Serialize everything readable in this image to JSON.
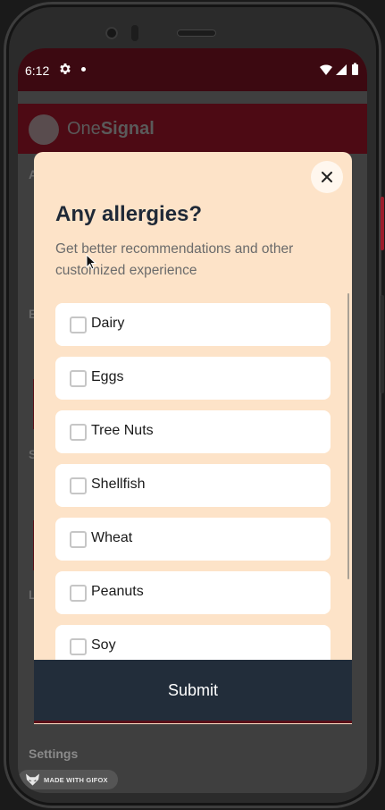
{
  "status_bar": {
    "time": "6:12"
  },
  "app_bar": {
    "title_light": "One",
    "title_bold": "Signal"
  },
  "background": {
    "labels": [
      "A",
      "E",
      "S",
      "L"
    ],
    "settings_label": "Settings"
  },
  "modal": {
    "title": "Any allergies?",
    "description": "Get better recommendations and other customized experience",
    "options": [
      {
        "label": "Dairy",
        "checked": false
      },
      {
        "label": "Eggs",
        "checked": false
      },
      {
        "label": "Tree Nuts",
        "checked": false
      },
      {
        "label": "Shellfish",
        "checked": false
      },
      {
        "label": "Wheat",
        "checked": false
      },
      {
        "label": "Peanuts",
        "checked": false
      },
      {
        "label": "Soy",
        "checked": false
      }
    ],
    "submit_label": "Submit"
  },
  "watermark": {
    "text": "MADE WITH GIFOX"
  },
  "colors": {
    "modal_bg": "#fde3c8",
    "submit_bg": "#222d3a",
    "status_bar": "#3c0911",
    "app_bar": "#4d0a14"
  }
}
